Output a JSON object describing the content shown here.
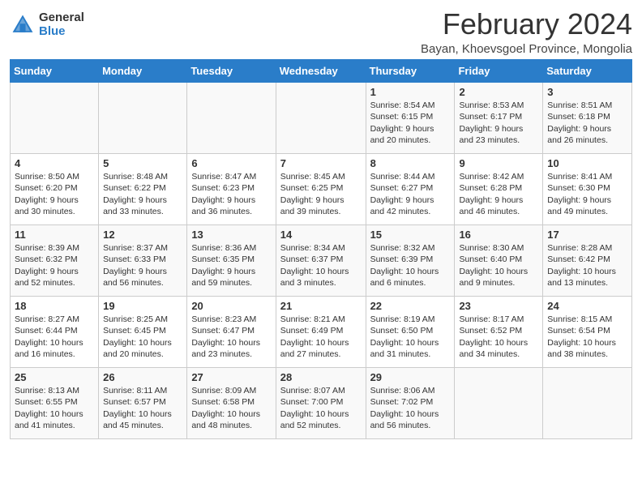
{
  "logo": {
    "general": "General",
    "blue": "Blue"
  },
  "title": "February 2024",
  "subtitle": "Bayan, Khoevsgoel Province, Mongolia",
  "headers": [
    "Sunday",
    "Monday",
    "Tuesday",
    "Wednesday",
    "Thursday",
    "Friday",
    "Saturday"
  ],
  "weeks": [
    [
      {
        "day": "",
        "info": ""
      },
      {
        "day": "",
        "info": ""
      },
      {
        "day": "",
        "info": ""
      },
      {
        "day": "",
        "info": ""
      },
      {
        "day": "1",
        "info": "Sunrise: 8:54 AM\nSunset: 6:15 PM\nDaylight: 9 hours\nand 20 minutes."
      },
      {
        "day": "2",
        "info": "Sunrise: 8:53 AM\nSunset: 6:17 PM\nDaylight: 9 hours\nand 23 minutes."
      },
      {
        "day": "3",
        "info": "Sunrise: 8:51 AM\nSunset: 6:18 PM\nDaylight: 9 hours\nand 26 minutes."
      }
    ],
    [
      {
        "day": "4",
        "info": "Sunrise: 8:50 AM\nSunset: 6:20 PM\nDaylight: 9 hours\nand 30 minutes."
      },
      {
        "day": "5",
        "info": "Sunrise: 8:48 AM\nSunset: 6:22 PM\nDaylight: 9 hours\nand 33 minutes."
      },
      {
        "day": "6",
        "info": "Sunrise: 8:47 AM\nSunset: 6:23 PM\nDaylight: 9 hours\nand 36 minutes."
      },
      {
        "day": "7",
        "info": "Sunrise: 8:45 AM\nSunset: 6:25 PM\nDaylight: 9 hours\nand 39 minutes."
      },
      {
        "day": "8",
        "info": "Sunrise: 8:44 AM\nSunset: 6:27 PM\nDaylight: 9 hours\nand 42 minutes."
      },
      {
        "day": "9",
        "info": "Sunrise: 8:42 AM\nSunset: 6:28 PM\nDaylight: 9 hours\nand 46 minutes."
      },
      {
        "day": "10",
        "info": "Sunrise: 8:41 AM\nSunset: 6:30 PM\nDaylight: 9 hours\nand 49 minutes."
      }
    ],
    [
      {
        "day": "11",
        "info": "Sunrise: 8:39 AM\nSunset: 6:32 PM\nDaylight: 9 hours\nand 52 minutes."
      },
      {
        "day": "12",
        "info": "Sunrise: 8:37 AM\nSunset: 6:33 PM\nDaylight: 9 hours\nand 56 minutes."
      },
      {
        "day": "13",
        "info": "Sunrise: 8:36 AM\nSunset: 6:35 PM\nDaylight: 9 hours\nand 59 minutes."
      },
      {
        "day": "14",
        "info": "Sunrise: 8:34 AM\nSunset: 6:37 PM\nDaylight: 10 hours\nand 3 minutes."
      },
      {
        "day": "15",
        "info": "Sunrise: 8:32 AM\nSunset: 6:39 PM\nDaylight: 10 hours\nand 6 minutes."
      },
      {
        "day": "16",
        "info": "Sunrise: 8:30 AM\nSunset: 6:40 PM\nDaylight: 10 hours\nand 9 minutes."
      },
      {
        "day": "17",
        "info": "Sunrise: 8:28 AM\nSunset: 6:42 PM\nDaylight: 10 hours\nand 13 minutes."
      }
    ],
    [
      {
        "day": "18",
        "info": "Sunrise: 8:27 AM\nSunset: 6:44 PM\nDaylight: 10 hours\nand 16 minutes."
      },
      {
        "day": "19",
        "info": "Sunrise: 8:25 AM\nSunset: 6:45 PM\nDaylight: 10 hours\nand 20 minutes."
      },
      {
        "day": "20",
        "info": "Sunrise: 8:23 AM\nSunset: 6:47 PM\nDaylight: 10 hours\nand 23 minutes."
      },
      {
        "day": "21",
        "info": "Sunrise: 8:21 AM\nSunset: 6:49 PM\nDaylight: 10 hours\nand 27 minutes."
      },
      {
        "day": "22",
        "info": "Sunrise: 8:19 AM\nSunset: 6:50 PM\nDaylight: 10 hours\nand 31 minutes."
      },
      {
        "day": "23",
        "info": "Sunrise: 8:17 AM\nSunset: 6:52 PM\nDaylight: 10 hours\nand 34 minutes."
      },
      {
        "day": "24",
        "info": "Sunrise: 8:15 AM\nSunset: 6:54 PM\nDaylight: 10 hours\nand 38 minutes."
      }
    ],
    [
      {
        "day": "25",
        "info": "Sunrise: 8:13 AM\nSunset: 6:55 PM\nDaylight: 10 hours\nand 41 minutes."
      },
      {
        "day": "26",
        "info": "Sunrise: 8:11 AM\nSunset: 6:57 PM\nDaylight: 10 hours\nand 45 minutes."
      },
      {
        "day": "27",
        "info": "Sunrise: 8:09 AM\nSunset: 6:58 PM\nDaylight: 10 hours\nand 48 minutes."
      },
      {
        "day": "28",
        "info": "Sunrise: 8:07 AM\nSunset: 7:00 PM\nDaylight: 10 hours\nand 52 minutes."
      },
      {
        "day": "29",
        "info": "Sunrise: 8:06 AM\nSunset: 7:02 PM\nDaylight: 10 hours\nand 56 minutes."
      },
      {
        "day": "",
        "info": ""
      },
      {
        "day": "",
        "info": ""
      }
    ]
  ]
}
